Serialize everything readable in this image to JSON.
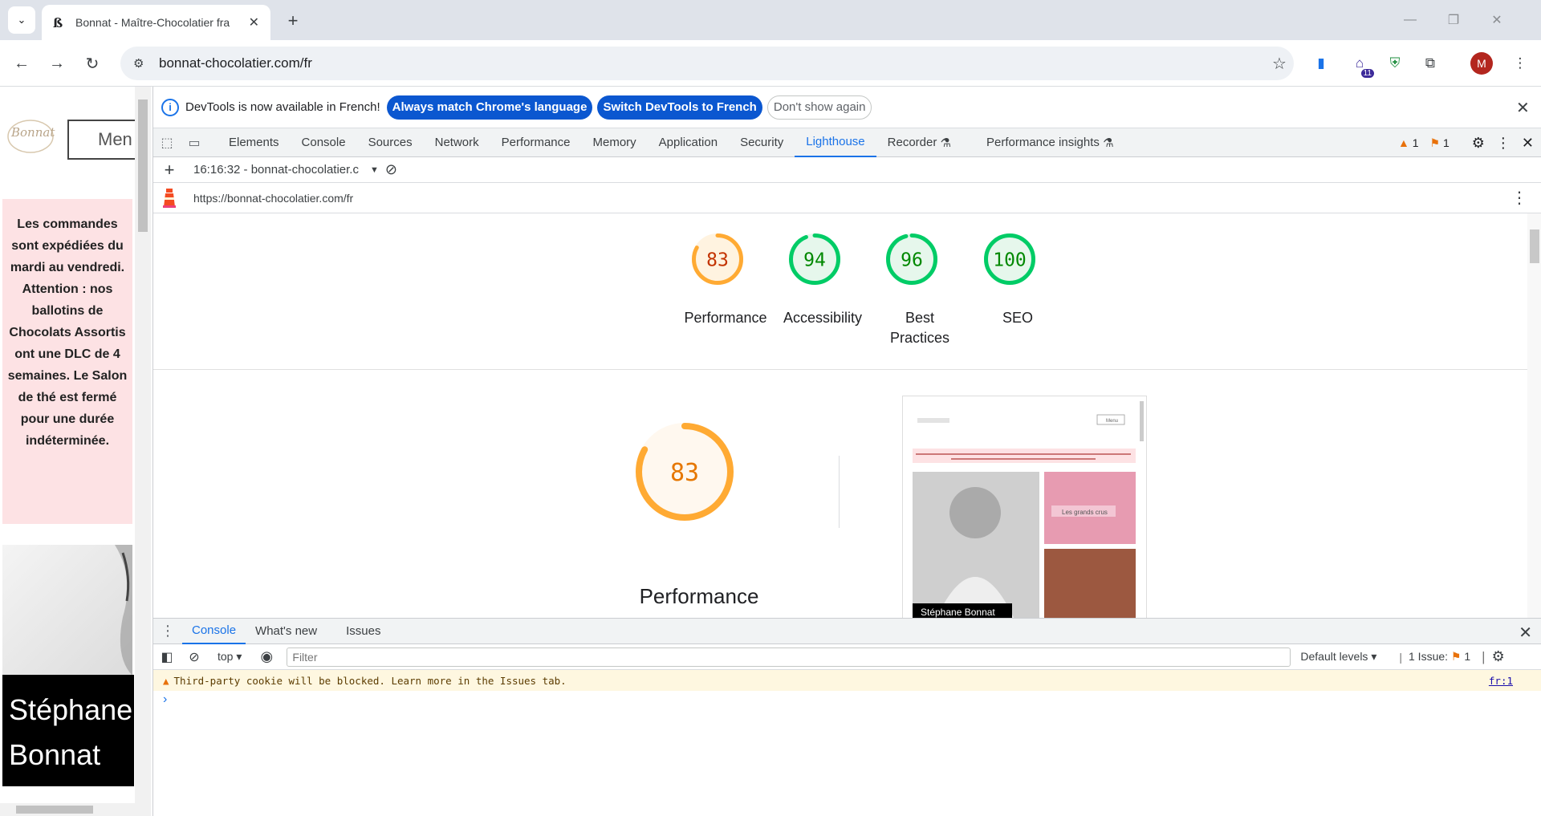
{
  "browser": {
    "tab_title": "Bonnat - Maître-Chocolatier fra",
    "url": "bonnat-chocolatier.com/fr",
    "profile_initial": "M",
    "ext_badge": "11"
  },
  "page": {
    "menu_label": "Men",
    "logo_text": "Bonnat",
    "notice": "Les commandes sont expédiées du mardi au vendredi. Attention : nos ballotins de Chocolats Assortis ont une DLC de 4 semaines. Le Salon de thé est fermé pour une durée indéterminée.",
    "banner_name": "Stéphane Bonnat"
  },
  "devtools": {
    "infobar": {
      "message": "DevTools is now available in French!",
      "btn_match": "Always match Chrome's language",
      "btn_switch": "Switch DevTools to French",
      "btn_dismiss": "Don't show again"
    },
    "tabs": [
      "Elements",
      "Console",
      "Sources",
      "Network",
      "Performance",
      "Memory",
      "Application",
      "Security",
      "Lighthouse",
      "Recorder",
      "Performance insights"
    ],
    "active_tab": "Lighthouse",
    "warnings_count": "1",
    "issues_count": "1",
    "report_select": "16:16:32 - bonnat-chocolatier.c",
    "report_url": "https://bonnat-chocolatier.com/fr",
    "scores": [
      {
        "label": "Performance",
        "value": 83,
        "color": "#fa3",
        "text_color": "#c33300",
        "bg": "#fff3e0"
      },
      {
        "label": "Accessibility",
        "value": 94,
        "color": "#0c6",
        "text_color": "#008800",
        "bg": "#e6f7ec"
      },
      {
        "label": "Best Practices",
        "value": 96,
        "color": "#0c6",
        "text_color": "#008800",
        "bg": "#e6f7ec"
      },
      {
        "label": "SEO",
        "value": 100,
        "color": "#0c6",
        "text_color": "#008800",
        "bg": "#e6f7ec"
      }
    ],
    "big_score": {
      "label": "Performance",
      "value": 83,
      "color": "#fa3",
      "text_color": "#e67700",
      "bg": "#fff8ef"
    },
    "screenshot": {
      "menu": "Menu",
      "caption": "Stéphane Bonnat",
      "tile": "Les grands crus"
    },
    "drawer": {
      "tabs": [
        "Console",
        "What's new",
        "Issues"
      ],
      "active": "Console",
      "context": "top",
      "filter_placeholder": "Filter",
      "levels": "Default levels",
      "issues_label": "1 Issue:",
      "issues_num": "1",
      "warning": "Third-party cookie will be blocked. Learn more in the Issues tab.",
      "warning_src": "fr:1"
    }
  }
}
